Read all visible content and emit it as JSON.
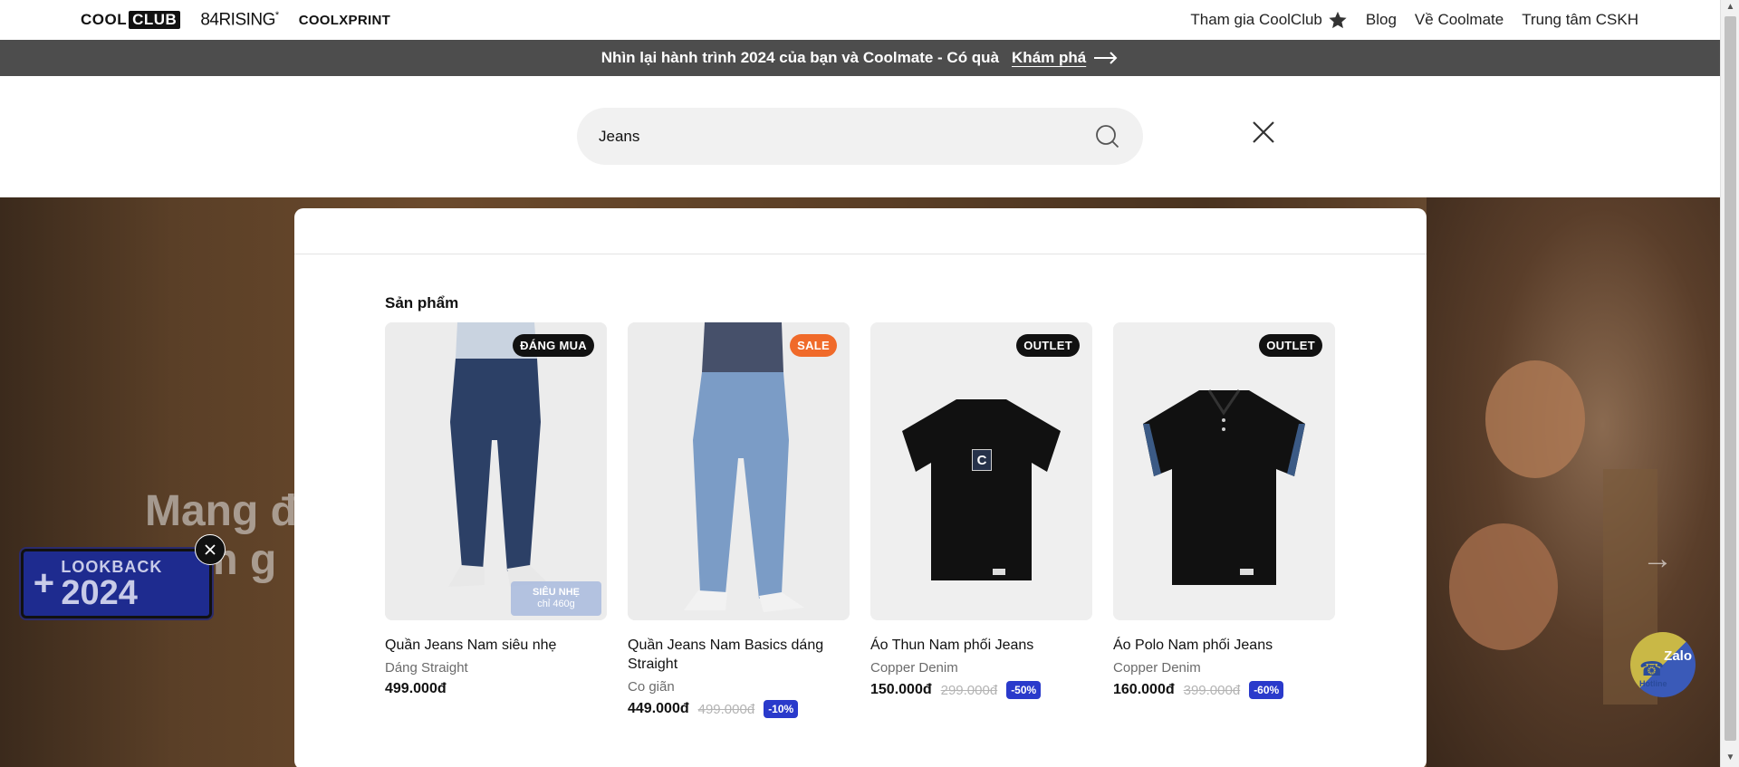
{
  "brands": {
    "coolclub_a": "COOL",
    "coolclub_b": "CLUB",
    "rising": "84RISING",
    "rising_mark": "*",
    "print": "COOLXPRINT"
  },
  "nav": {
    "join": "Tham gia CoolClub",
    "blog": "Blog",
    "about": "Về Coolmate",
    "support": "Trung tâm CSKH"
  },
  "announcement": {
    "text": "Nhìn lại hành trình 2024 của bạn và Coolmate - Có quà",
    "cta": "Khám phá"
  },
  "search": {
    "value": "Jeans"
  },
  "hero": {
    "line1": "Mang đ",
    "line2": "m g"
  },
  "lookback": {
    "label": "LOOKBACK",
    "year": "2024"
  },
  "zalo": {
    "title": "Zalo",
    "hotline": "Hotline"
  },
  "results": {
    "section_title": "Sản phẩm",
    "products": [
      {
        "badge": "ĐÁNG MUA",
        "name": "Quần Jeans Nam siêu nhẹ",
        "sub": "Dáng Straight",
        "price": "499.000đ",
        "old_price": "",
        "discount": "",
        "tag_line1": "SIÊU NHẸ",
        "tag_line2": "chỉ 460g"
      },
      {
        "badge": "SALE",
        "name": "Quần Jeans Nam Basics dáng Straight",
        "sub": "Co giãn",
        "price": "449.000đ",
        "old_price": "499.000đ",
        "discount": "-10%"
      },
      {
        "badge": "OUTLET",
        "name": "Áo Thun Nam phối Jeans",
        "sub": "Copper Denim",
        "price": "150.000đ",
        "old_price": "299.000đ",
        "discount": "-50%",
        "logo": "C"
      },
      {
        "badge": "OUTLET",
        "name": "Áo Polo Nam phối Jeans",
        "sub": "Copper Denim",
        "price": "160.000đ",
        "old_price": "399.000đ",
        "discount": "-60%"
      }
    ]
  },
  "colors": {
    "announce_bg": "#4d4d4d",
    "sale_badge": "#f06a2a",
    "discount": "#2a3acb",
    "search_bg": "#f1f1f1"
  },
  "icons": {
    "star": "star-icon",
    "arrow": "arrow-right-icon",
    "search": "search-icon",
    "close": "close-icon"
  }
}
